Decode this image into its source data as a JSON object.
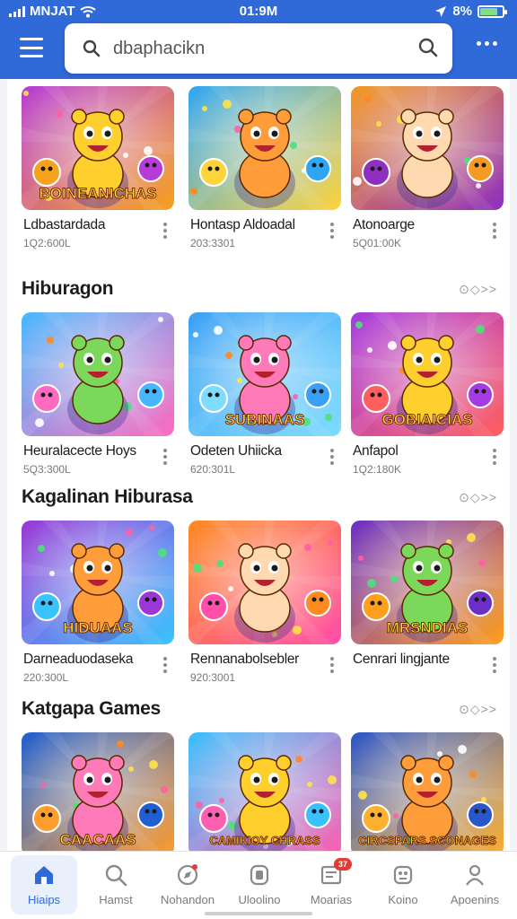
{
  "status_bar": {
    "carrier": "MNJAT",
    "time": "01:9M",
    "battery_percent": "8%",
    "battery_level": 0.8
  },
  "search": {
    "value": "",
    "placeholder": "dbaphacikn"
  },
  "sections": [
    {
      "title": "",
      "more_label": "",
      "items": [
        {
          "title": "Ldbastardada",
          "meta": "1Q2:600L",
          "art": "BOINEANICHAS",
          "bg": [
            "#b63bd8",
            "#f7a21c"
          ],
          "icon": "guitar-character"
        },
        {
          "title": "Hontasp Aldoadal",
          "meta": "203:3301",
          "art": "",
          "bg": [
            "#2ea6f2",
            "#ffd43b"
          ],
          "icon": "number-seven-character"
        },
        {
          "title": "Atonoarge",
          "meta": "5Q01:00K",
          "art": "",
          "bg": [
            "#f59a23",
            "#8e2fbf"
          ],
          "icon": "bear-character"
        }
      ]
    },
    {
      "title": "Hiburagon",
      "more_label": "⊙◇>>",
      "items": [
        {
          "title": "Heuralacecte Hoys",
          "meta": "5Q3:300L",
          "art": "",
          "bg": [
            "#47b8ff",
            "#ff6ac1"
          ],
          "icon": "orange-blob-character"
        },
        {
          "title": "Odeten Uhiicka",
          "meta": "620:301L",
          "art": "SUBINAAS",
          "bg": [
            "#3aa0f5",
            "#7fdcff"
          ],
          "icon": "hamster-character"
        },
        {
          "title": "Anfapol",
          "meta": "1Q2:180K",
          "art": "GOBIAICIAS",
          "bg": [
            "#a53be0",
            "#ff5f5f"
          ],
          "icon": "cat-hero-character"
        }
      ]
    },
    {
      "title": "Kagalinan Hiburasa",
      "more_label": "⊙◇>>",
      "items": [
        {
          "title": "Darneaduodaseka",
          "meta": "220:300L",
          "art": "HIDUAAS",
          "bg": [
            "#9b37d6",
            "#39c4ff"
          ],
          "icon": "green-frog-character"
        },
        {
          "title": "Rennanabolsebler",
          "meta": "920:3001",
          "art": "",
          "bg": [
            "#ff8a1f",
            "#ff4fa8"
          ],
          "icon": "yellow-creature-character"
        },
        {
          "title": "Cenrari lingjante",
          "meta": "",
          "art": "MRSNDIAS",
          "bg": [
            "#6b2fc7",
            "#ff9f1c"
          ],
          "icon": "crowd-characters"
        }
      ]
    },
    {
      "title": "Katgapa Games",
      "more_label": "⊙◇>>",
      "items": [
        {
          "title": "",
          "meta": "",
          "art": "CAACAAS",
          "bg": [
            "#1f5fd1",
            "#ff9d2e"
          ],
          "icon": "adventurer-characters"
        },
        {
          "title": "",
          "meta": "",
          "art": "CAMIKIOY CHRASS",
          "bg": [
            "#39c0ff",
            "#ff5fb0"
          ],
          "icon": "candy-characters"
        },
        {
          "title": "",
          "meta": "",
          "art": "CIRCSPARS SCONAGES",
          "bg": [
            "#2b56c9",
            "#ffb02e"
          ],
          "icon": "party-characters"
        }
      ]
    }
  ],
  "bottom_nav": [
    {
      "label": "Hiaips",
      "icon": "home-icon",
      "active": true
    },
    {
      "label": "Hamst",
      "icon": "search-icon"
    },
    {
      "label": "Nohandon",
      "icon": "compass-icon"
    },
    {
      "label": "Uloolino",
      "icon": "gamepad-icon"
    },
    {
      "label": "Moarias",
      "icon": "inbox-icon",
      "badge": "37"
    },
    {
      "label": "Koino",
      "icon": "game-controller-icon"
    },
    {
      "label": "Apoenins",
      "icon": "profile-icon"
    }
  ],
  "colors": {
    "accent": "#2f6ad8",
    "top_bar": "#2f6ad8",
    "badge": "#e53935"
  }
}
